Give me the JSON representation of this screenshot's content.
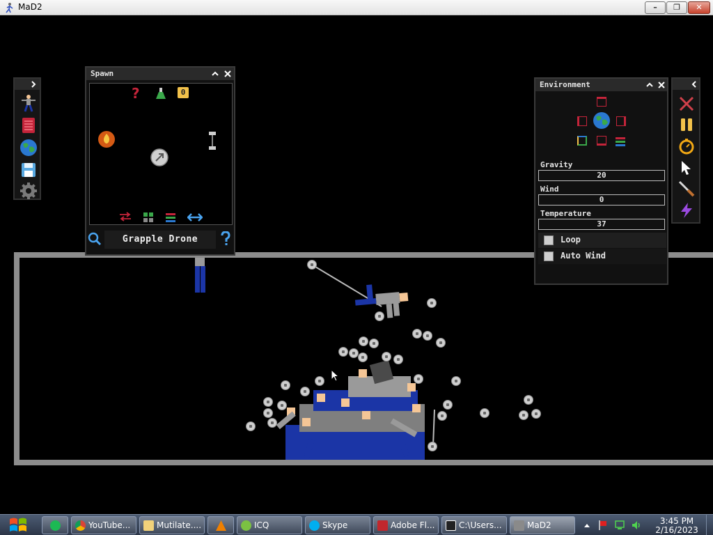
{
  "window": {
    "title": "MaD2"
  },
  "spawn_panel": {
    "title": "Spawn",
    "selected_item": "Grapple Drone",
    "count_badge": "0",
    "question_mark": "?"
  },
  "environment": {
    "title": "Environment",
    "gravity": {
      "label": "Gravity",
      "value": "20"
    },
    "wind": {
      "label": "Wind",
      "value": "0"
    },
    "temperature": {
      "label": "Temperature",
      "value": "37"
    },
    "loop": {
      "label": "Loop",
      "checked": false
    },
    "auto_wind": {
      "label": "Auto Wind",
      "checked": false
    }
  },
  "taskbar": {
    "items": [
      {
        "label": "YouTube...",
        "icon": "chrome-icon"
      },
      {
        "label": "Mutilate....",
        "icon": "folder-icon"
      },
      {
        "label": "",
        "icon": "vlc-icon"
      },
      {
        "label": "ICQ",
        "icon": "icq-icon"
      },
      {
        "label": "Skype",
        "icon": "skype-icon"
      },
      {
        "label": "Adobe Fl...",
        "icon": "flash-icon"
      },
      {
        "label": "C:\\Users...",
        "icon": "7zip-icon"
      },
      {
        "label": "MaD2",
        "icon": "mad2-icon"
      }
    ],
    "time": "3:45 PM",
    "date": "2/16/2023"
  },
  "colors": {
    "panel_bg": "#111111",
    "arena_border": "#8c8c8c",
    "ragdoll_blue": "#1b35a6",
    "ragdoll_gray": "#9a9a9a",
    "skin": "#f5c696"
  }
}
